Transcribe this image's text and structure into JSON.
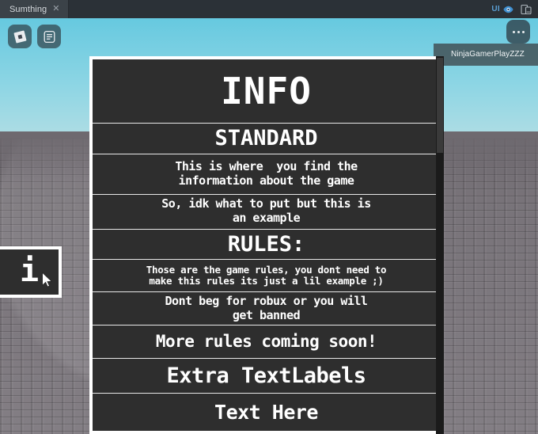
{
  "window": {
    "tab": {
      "label": "Sumthing",
      "close_icon": "close-icon"
    },
    "right_controls": {
      "ui_label": "UI",
      "eye_icon": "eye-icon",
      "device_icon": "device-preview-icon"
    },
    "background": "#2b3137"
  },
  "game_overlay": {
    "roblox_button_icon": "roblox-logo-icon",
    "menu_button_icon": "list-menu-icon",
    "more_button_icon": "ellipsis-icon",
    "player_nametag": "NinjaGamerPlayZZZ"
  },
  "scene": {
    "sky_color": "#8fd6e4",
    "ground_color": "#787379"
  },
  "info_button": {
    "label": "i"
  },
  "info_panel": {
    "border_color": "#ffffff",
    "background_color": "#2e2e2e",
    "text_color": "#ffffff",
    "rows": [
      {
        "text": "INFO"
      },
      {
        "text": "STANDARD"
      },
      {
        "text": "This is where  you find the\ninformation about the game"
      },
      {
        "text": "So, idk what to put but this is\nan example"
      },
      {
        "text": "RULES:"
      },
      {
        "text": "Those are the game rules, you dont need to\nmake this rules its just a lil example ;)"
      },
      {
        "text": "Dont beg for robux or you will\nget banned"
      },
      {
        "text": "More rules coming soon!"
      },
      {
        "text": "Extra TextLabels"
      },
      {
        "text": "Text Here"
      }
    ]
  }
}
